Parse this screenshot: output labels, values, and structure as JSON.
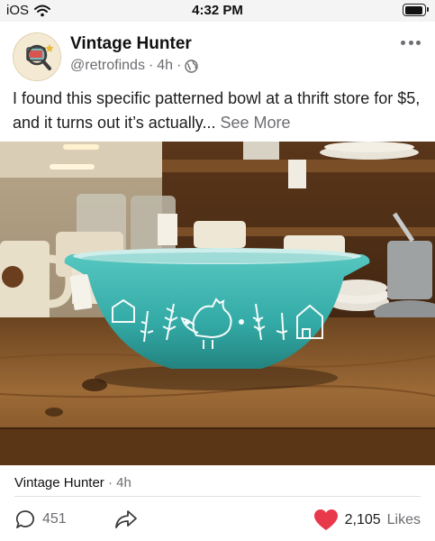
{
  "status_bar": {
    "carrier": "iOS",
    "time": "4:32 PM",
    "icons": [
      "wifi-icon",
      "battery-icon"
    ]
  },
  "post": {
    "author": {
      "name": "Vintage Hunter",
      "handle": "@retrofinds",
      "age": "4h",
      "visibility_icon": "globe-icon",
      "avatar_icon": "magnifier-monitor-icon"
    },
    "more_icon": "ellipsis-icon",
    "text": "I found this specific patterned bowl at a thrift store for $5, and it turns out it’s actually...",
    "see_more_label": "See More",
    "photo": {
      "subject": "turquoise mixing bowl with white rooster and wheat pattern on a wooden table",
      "colors": {
        "bowl": "#3ab5b0",
        "table": "#8a5a2c"
      }
    },
    "footer": {
      "author_name": "Vintage Hunter",
      "age": "4h",
      "comments_count": "451",
      "likes_count": "2,105",
      "likes_label": "Likes"
    }
  },
  "colors": {
    "accent_like": "#e8394b",
    "muted_text": "#6d6d72"
  }
}
